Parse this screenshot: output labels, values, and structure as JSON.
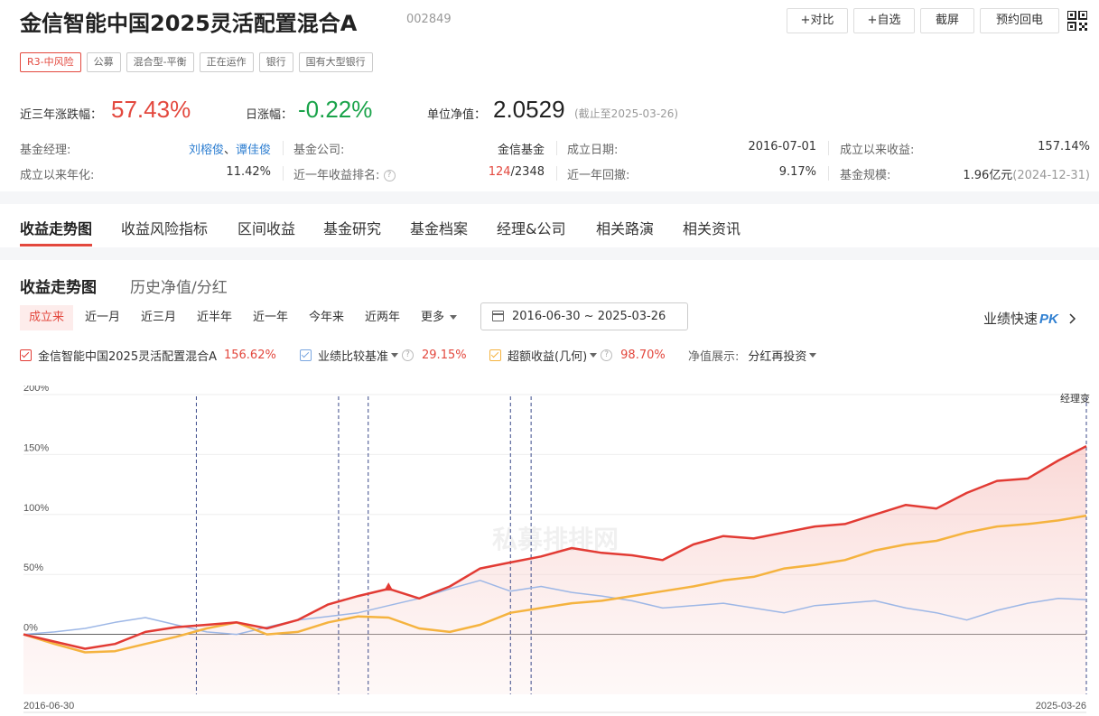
{
  "header": {
    "title": "金信智能中国2025灵活配置混合A",
    "code": "002849",
    "buttons": [
      "+对比",
      "+自选",
      "截屏",
      "预约回电"
    ],
    "tags": [
      "R3-中风险",
      "公募",
      "混合型-平衡",
      "正在运作",
      "银行",
      "国有大型银行"
    ]
  },
  "stats": {
    "three_year_label": "近三年涨跌幅：",
    "three_year_value": "57.43%",
    "daily_label": "日涨幅：",
    "daily_value": "-0.22%",
    "nav_label": "单位净值：",
    "nav_value": "2.0529",
    "nav_date": "(截止至2025-03-26)"
  },
  "info": {
    "manager_label": "基金经理:",
    "manager_1": "刘榕俊",
    "manager_sep": "、",
    "manager_2": "谭佳俊",
    "company_label": "基金公司:",
    "company_value": "金信基金",
    "inception_label": "成立日期:",
    "inception_value": "2016-07-01",
    "since_label": "成立以来收益:",
    "since_value": "157.14%",
    "annual_label": "成立以来年化:",
    "annual_value": "11.42%",
    "rank_label": "近一年收益排名:",
    "rank_value": "124",
    "rank_total": "/2348",
    "drawdown_label": "近一年回撤:",
    "drawdown_value": "9.17%",
    "size_label": "基金规模:",
    "size_value": "1.96亿元",
    "size_date": "(2024-12-31)"
  },
  "nav": [
    "收益走势图",
    "收益风险指标",
    "区间收益",
    "基金研究",
    "基金档案",
    "经理&公司",
    "相关路演",
    "相关资讯"
  ],
  "panel": {
    "sub_tabs": [
      "收益走势图",
      "历史净值/分红"
    ],
    "periods": [
      "成立来",
      "近一月",
      "近三月",
      "近半年",
      "近一年",
      "今年来",
      "近两年",
      "更多"
    ],
    "date_range": "2016-06-30 ~ 2025-03-26",
    "pk_label": "业绩快速",
    "pk_badge": "PK",
    "legend": {
      "fund_name": "金信智能中国2025灵活配置混合A",
      "fund_value": "156.62%",
      "bench_name": "业绩比较基准",
      "bench_value": "29.15%",
      "excess_name": "超额收益(几何)",
      "excess_value": "98.70%",
      "nav_show_label": "净值展示:",
      "nav_show_value": "分红再投资"
    },
    "watermark": "私募排排网",
    "manager_change": "经理变"
  },
  "colors": {
    "fund": "#e23b34",
    "bench": "#9db7e6",
    "excess": "#f5b33f",
    "accent": "#e3483e",
    "blue": "#2f7fd1"
  },
  "chart_data": {
    "type": "line",
    "x_start": "2016-06-30",
    "x_end": "2025-03-26",
    "ylim": [
      -50,
      200
    ],
    "y_ticks": [
      "200%",
      "150%",
      "100%",
      "50%",
      "0%"
    ],
    "x_ticks": [
      "2016-06-30",
      "2025-03-26"
    ],
    "manager_change_dates": [
      "2017-12-01",
      "2019-02-01",
      "2019-05-01",
      "2020-07-01",
      "2020-09-01",
      "2025-03-26"
    ],
    "x": [
      "2016-06-30",
      "2016-10-01",
      "2017-01-01",
      "2017-04-01",
      "2017-07-01",
      "2017-10-01",
      "2018-01-01",
      "2018-04-01",
      "2018-07-01",
      "2018-10-01",
      "2019-01-01",
      "2019-04-01",
      "2019-07-01",
      "2019-10-01",
      "2020-01-01",
      "2020-04-01",
      "2020-07-01",
      "2020-10-01",
      "2021-01-01",
      "2021-04-01",
      "2021-07-01",
      "2021-10-01",
      "2022-01-01",
      "2022-04-01",
      "2022-07-01",
      "2022-10-01",
      "2023-01-01",
      "2023-04-01",
      "2023-07-01",
      "2023-10-01",
      "2024-01-01",
      "2024-04-01",
      "2024-07-01",
      "2024-10-01",
      "2025-01-01",
      "2025-03-26"
    ],
    "series": [
      {
        "name": "金信智能中国2025灵活配置混合A",
        "values": [
          0,
          -6,
          -12,
          -8,
          2,
          6,
          8,
          10,
          5,
          12,
          25,
          32,
          38,
          30,
          40,
          55,
          60,
          65,
          72,
          68,
          66,
          62,
          75,
          82,
          80,
          85,
          90,
          92,
          100,
          108,
          105,
          118,
          128,
          130,
          145,
          157
        ]
      },
      {
        "name": "业绩比较基准",
        "values": [
          0,
          2,
          5,
          10,
          14,
          8,
          2,
          0,
          6,
          12,
          15,
          18,
          24,
          30,
          38,
          45,
          36,
          40,
          35,
          32,
          28,
          22,
          24,
          26,
          22,
          18,
          24,
          26,
          28,
          22,
          18,
          12,
          20,
          26,
          30,
          29
        ]
      },
      {
        "name": "超额收益(几何)",
        "values": [
          0,
          -8,
          -15,
          -14,
          -8,
          -2,
          5,
          10,
          0,
          2,
          10,
          15,
          14,
          5,
          2,
          8,
          18,
          22,
          26,
          28,
          32,
          36,
          40,
          45,
          48,
          55,
          58,
          62,
          70,
          75,
          78,
          85,
          90,
          92,
          95,
          99
        ]
      }
    ]
  }
}
